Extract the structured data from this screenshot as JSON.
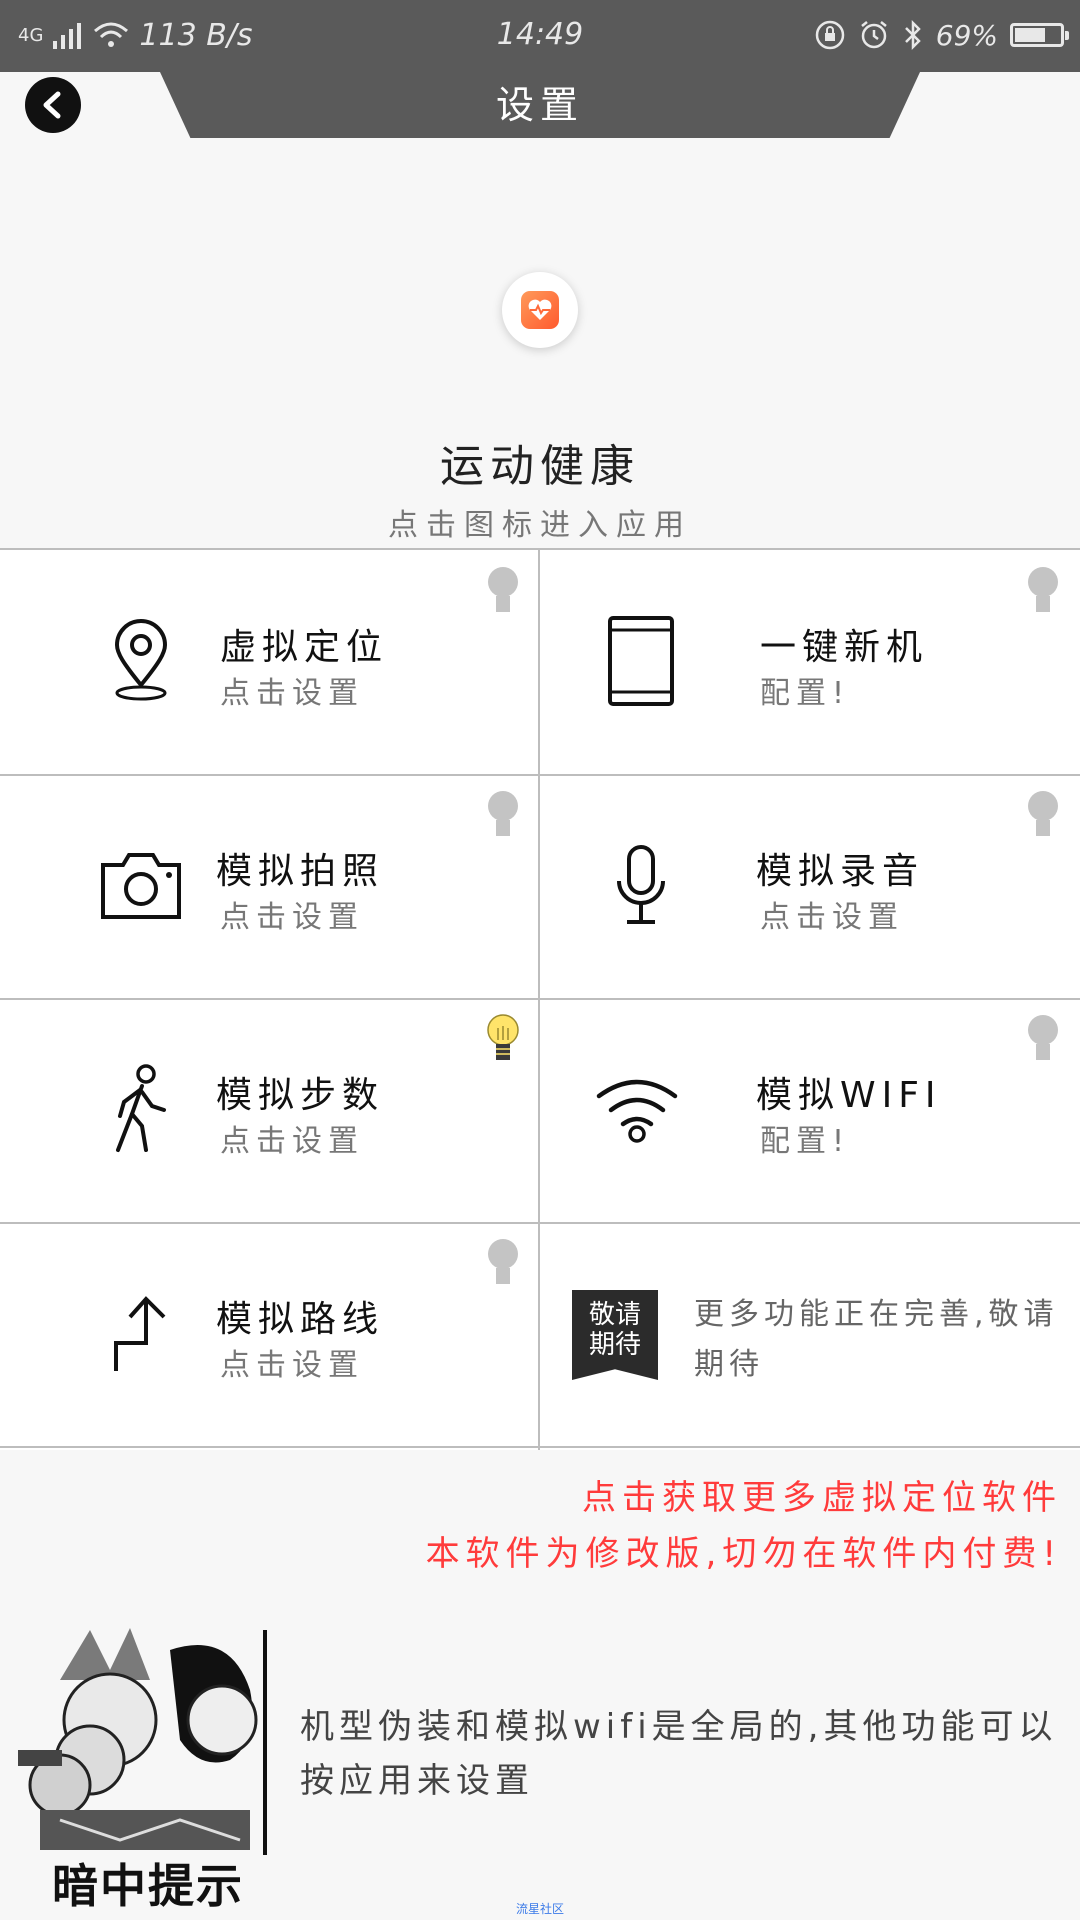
{
  "status_bar": {
    "network": "4G",
    "speed": "113 B/s",
    "time": "14:49",
    "battery": "69%",
    "battery_level": 0.69
  },
  "header": {
    "title": "设置",
    "back_icon": "chevron-left-icon"
  },
  "app": {
    "name": "运动健康",
    "hint": "点击图标进入应用",
    "icon_color": "#ff6a3a"
  },
  "features": [
    {
      "title": "虚拟定位",
      "sub": "点击设置",
      "icon": "location-pin-icon",
      "bulb_on": false
    },
    {
      "title": "一键新机",
      "sub": "配置!",
      "icon": "phone-device-icon",
      "bulb_on": false
    },
    {
      "title": "模拟拍照",
      "sub": "点击设置",
      "icon": "camera-icon",
      "bulb_on": false
    },
    {
      "title": "模拟录音",
      "sub": "点击设置",
      "icon": "microphone-icon",
      "bulb_on": false
    },
    {
      "title": "模拟步数",
      "sub": "点击设置",
      "icon": "walking-icon",
      "bulb_on": true
    },
    {
      "title": "模拟WIFI",
      "sub": "配置!",
      "icon": "wifi-icon",
      "bulb_on": false
    },
    {
      "title": "模拟路线",
      "sub": "点击设置",
      "icon": "route-icon",
      "bulb_on": false
    }
  ],
  "coming_soon": {
    "badge_line1": "敬请",
    "badge_line2": "期待",
    "text": "更多功能正在完善,敬请期待"
  },
  "notices": {
    "line1": "点击获取更多虚拟定位软件",
    "line2": "本软件为修改版,切勿在软件内付费!",
    "color": "#ff3b3b"
  },
  "tip": {
    "image_caption": "暗中提示",
    "text": "机型伪装和模拟wifi是全局的,其他功能可以按应用来设置"
  },
  "watermark": "流星社区"
}
